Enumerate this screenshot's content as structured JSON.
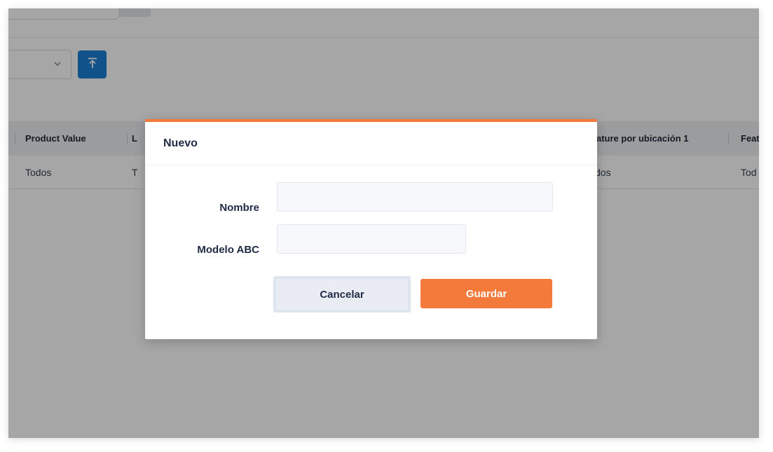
{
  "background": {
    "table": {
      "headers": [
        "Product Value",
        "L",
        "ature por ubicación 1",
        "Feat"
      ],
      "row": [
        "Todos",
        "T",
        "dos",
        "Tod"
      ]
    }
  },
  "modal": {
    "title": "Nuevo",
    "fields": {
      "nombre_label": "Nombre",
      "nombre_value": "",
      "modelo_label": "Modelo ABC",
      "modelo_value": ""
    },
    "buttons": {
      "cancel": "Cancelar",
      "save": "Guardar"
    }
  },
  "colors": {
    "accent": "#f47a3b",
    "primary_blue": "#1c7ed6",
    "overlay": "rgba(0,0,0,0.35)"
  },
  "icons": {
    "chevron": "chevron-down-icon",
    "upload": "upload-icon"
  }
}
